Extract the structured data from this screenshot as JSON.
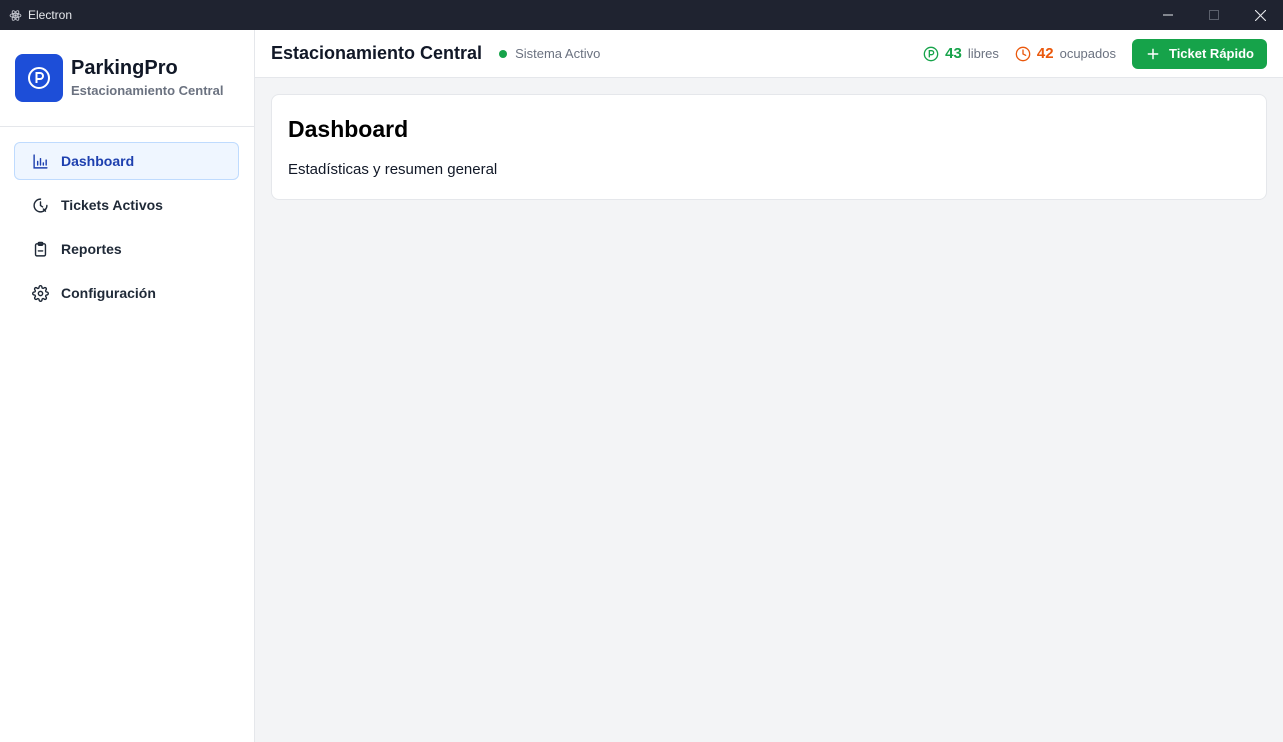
{
  "window": {
    "title": "Electron"
  },
  "brand": {
    "name": "ParkingPro",
    "subtitle": "Estacionamiento Central",
    "logo_icon": "parking-p-icon"
  },
  "nav": {
    "items": [
      {
        "label": "Dashboard",
        "icon": "bar-chart-icon",
        "active": true
      },
      {
        "label": "Tickets Activos",
        "icon": "clock-icon",
        "active": false
      },
      {
        "label": "Reportes",
        "icon": "clipboard-icon",
        "active": false
      },
      {
        "label": "Configuración",
        "icon": "gear-icon",
        "active": false
      }
    ]
  },
  "header": {
    "title": "Estacionamiento Central",
    "status": "Sistema Activo",
    "free_count": "43",
    "free_label": "libres",
    "busy_count": "42",
    "busy_label": "ocupados",
    "quick_ticket_label": "Ticket Rápido"
  },
  "page": {
    "title": "Dashboard",
    "subtitle": "Estadísticas y resumen general"
  },
  "colors": {
    "brand": "#1d4ed8",
    "success": "#16a34a",
    "warning": "#ea580c",
    "active_nav_bg": "#eff6ff"
  }
}
